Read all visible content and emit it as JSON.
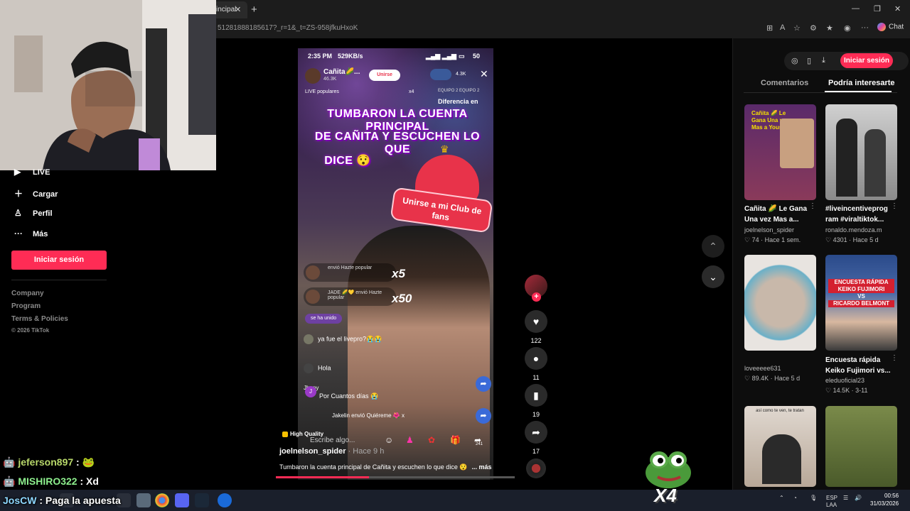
{
  "browser": {
    "tab_label": "incipal",
    "url": "51281888185617?_r=1&_t=ZS-958jfkuHxoK",
    "chat_label": "Chat"
  },
  "sidebar": {
    "items": [
      {
        "label": "LIVE",
        "icon": "live-icon"
      },
      {
        "label": "Cargar",
        "icon": "plus-icon"
      },
      {
        "label": "Perfil",
        "icon": "person-icon"
      },
      {
        "label": "Más",
        "icon": "ellipsis-icon"
      }
    ],
    "login_label": "Iniciar sesión",
    "footer": [
      "Company",
      "Program",
      "Terms & Policies"
    ],
    "copyright": "© 2026 TikTok"
  },
  "video": {
    "status_time": "2:35 PM",
    "status_speed": "529KB/s",
    "status_battery": "50",
    "host_name": "Cañita🌽...",
    "host_likes": "46.3K",
    "join_label": "Unirse",
    "viewers": "4.3K",
    "live_popular": "LIVE populares",
    "x4": "x4",
    "teams": "EQUIPO 2  EQUIPO 2",
    "difference": "Diferencia en",
    "overlay_lines": [
      "TUMBARON LA CUENTA PRINCIPAL",
      "DE CAÑITA Y ESCUCHEN LO QUE",
      "DICE 😯"
    ],
    "club_label": "Unirse a mi Club de fans",
    "gifts": [
      {
        "text": "envió Hazte popular",
        "count": "x5"
      },
      {
        "text": "JADE 🌽💛 envió Hazte popular",
        "count": "x50"
      }
    ],
    "joined_text": "se ha unido",
    "chat": [
      {
        "text": "ya fue el livepro?😭😭"
      },
      {
        "text": "Hola"
      },
      {
        "name": "Jhony",
        "text": "Por Cuantos días 😭"
      },
      {
        "text": "Jakelin envió Quiéreme 🌺 x"
      }
    ],
    "high_quality": "High Quality",
    "write_placeholder": "Escribe algo...",
    "gift_count": "241",
    "username": "joelnelson_spider",
    "time_ago": " · Hace 9 h",
    "caption": "Tumbaron la cuenta principal de Cañita y escuchen lo que dice 😯",
    "more_label": "... más",
    "progress": 0.39
  },
  "actions": {
    "likes": "122",
    "comments": "11",
    "saves": "19",
    "shares": "17"
  },
  "right_panel": {
    "login_label": "Iniciar sesión",
    "tabs": [
      "Comentarios",
      "Podría interesarte"
    ],
    "recs": [
      {
        "title": "Cañita 🌽 Le Gana Una vez Mas a...",
        "author": "joelnelson_spider",
        "likes": "74",
        "time": "Hace 1 sem.",
        "thumb_color": "#5a2a6a"
      },
      {
        "title": "#liveincentiveprog ram #viraltiktok...",
        "author": "ronaldo.mendoza.m",
        "likes": "4301",
        "time": "Hace 5 d",
        "thumb_color": "#c8c8c8"
      },
      {
        "title": "",
        "author": "loveeeee631",
        "likes": "89.4K",
        "time": "Hace 5 d",
        "thumb_color": "#b9a89a"
      },
      {
        "title": "Encuesta rápida Keiko Fujimori vs...",
        "author": "eleduoficial23",
        "likes": "14.5K",
        "time": "3-11",
        "thumb_color": "#3a5a9a"
      },
      {
        "title": "",
        "author": "",
        "likes": "",
        "time": "",
        "thumb_color": "#d8d0c8"
      },
      {
        "title": "",
        "author": "",
        "likes": "",
        "time": "",
        "thumb_color": "#5a6a3a"
      }
    ],
    "thumb_texts": {
      "rec1": "Cañita 🌽 Le Gana Una vez Mas a Yousia",
      "rec4_lines": [
        "ENCUESTA RÁPIDA",
        "KEIKO FUJIMORI",
        "VS",
        "RICARDO BELMONT"
      ],
      "rec5": "así como te ven, te tratan"
    }
  },
  "stream_chat": [
    {
      "user": "jeferson897",
      "msg": ""
    },
    {
      "user": "MISHIRO322",
      "msg": "Xd"
    },
    {
      "user": "JosCW",
      "msg": "Paga la apuesta"
    }
  ],
  "pepe_label": "X4",
  "taskbar": {
    "lang": "ESP",
    "region": "LAA",
    "time": "00:56",
    "date": "31/03/2026"
  }
}
